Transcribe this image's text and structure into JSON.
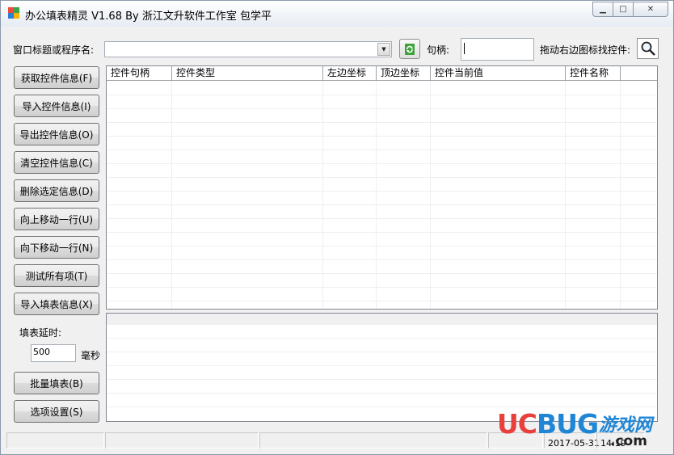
{
  "window": {
    "title": "办公填表精灵 V1.68 By 浙江文升软件工作室 包学平",
    "controls": {
      "minimize": "▁",
      "maximize": "□",
      "close": "✕"
    }
  },
  "toolbar": {
    "window_label": "窗口标题或程序名:",
    "combo_value": "",
    "handle_label": "句柄:",
    "handle_value": "",
    "finder_label": "拖动右边图标找控件:"
  },
  "buttons": [
    "获取控件信息(F)",
    "导入控件信息(I)",
    "导出控件信息(O)",
    "清空控件信息(C)",
    "删除选定信息(D)",
    "向上移动一行(U)",
    "向下移动一行(N)",
    "测试所有项(T)",
    "导入填表信息(X)"
  ],
  "delay": {
    "label": "填表延时:",
    "value": "500",
    "unit": "毫秒"
  },
  "batch_button": "批量填表(B)",
  "options_button": "选项设置(S)",
  "grid": {
    "columns": [
      "控件句柄",
      "控件类型",
      "左边坐标",
      "顶边坐标",
      "控件当前值",
      "控件名称"
    ]
  },
  "statusbar": {
    "date": "2017-05-31",
    "time": "14:19"
  },
  "watermark": {
    "brand_a": "UC",
    "brand_b": "BUG",
    "cn": "游戏网",
    "domain": ".com"
  },
  "icons": {
    "app": "app-icon",
    "refresh": "refresh-icon",
    "finder": "magnifier-icon",
    "dropdown": "chevron-down-icon"
  }
}
